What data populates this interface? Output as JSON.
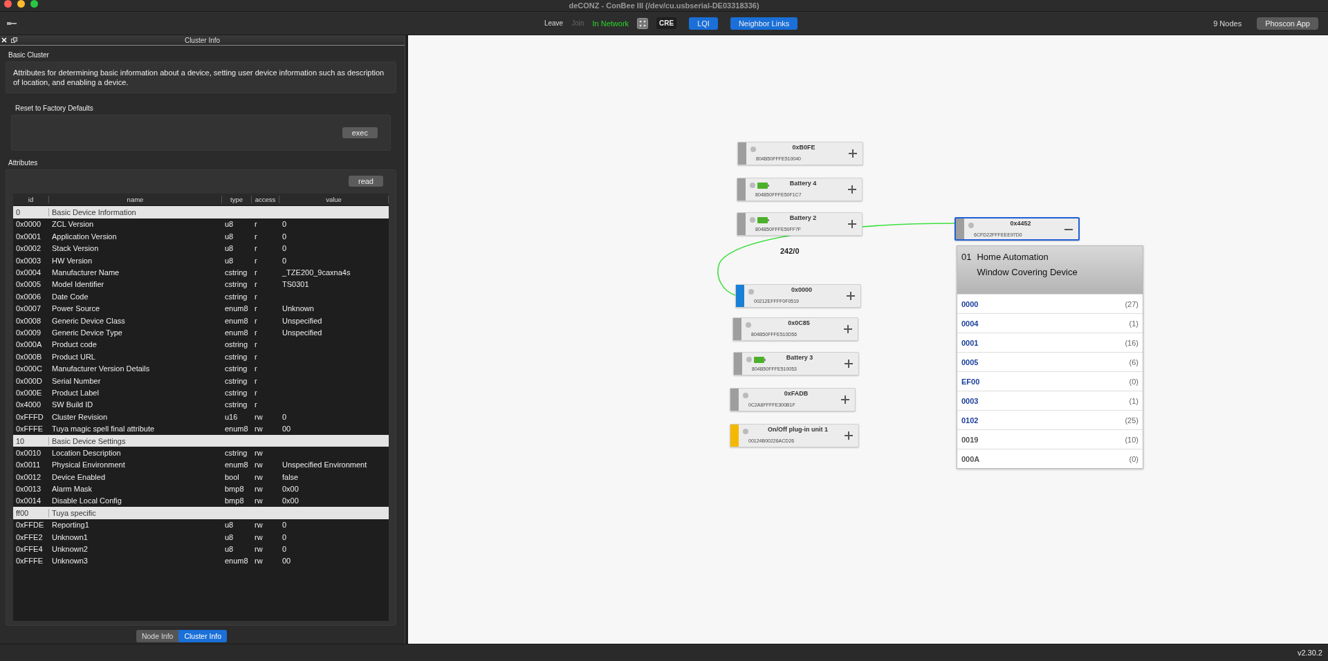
{
  "window": {
    "title": "deCONZ - ConBee III (/dev/cu.usbserial-DE03318336)"
  },
  "toolbar": {
    "leave": {
      "label": "Leave",
      "disabled": false
    },
    "join": {
      "label": "Join",
      "disabled": true
    },
    "status": "In Network",
    "cre": "CRE",
    "toggles": [
      {
        "label": "LQI",
        "on": true
      },
      {
        "label": "Neighbor Links",
        "on": true
      }
    ],
    "node_count": "9 Nodes",
    "phoscon_button": "Phoscon App"
  },
  "cluster_panel": {
    "title": "Cluster Info",
    "cluster_name": "Basic Cluster",
    "description": "Attributes for determining basic information about a device, setting user device information such as description of location, and enabling a device.",
    "commands": [
      {
        "name": "Reset to Factory Defaults",
        "button": "exec"
      }
    ],
    "attributes": {
      "title": "Attributes",
      "read_button": "read",
      "columns": [
        "id",
        "name",
        "type",
        "access",
        "value"
      ],
      "rows": [
        {
          "kind": "group",
          "id": "0",
          "name": "Basic Device Information"
        },
        {
          "kind": "attribute",
          "id": "0x0000",
          "name": "ZCL Version",
          "type": "u8",
          "access": "r",
          "value": "0"
        },
        {
          "kind": "attribute",
          "id": "0x0001",
          "name": "Application Version",
          "type": "u8",
          "access": "r",
          "value": "0"
        },
        {
          "kind": "attribute",
          "id": "0x0002",
          "name": "Stack Version",
          "type": "u8",
          "access": "r",
          "value": "0"
        },
        {
          "kind": "attribute",
          "id": "0x0003",
          "name": "HW Version",
          "type": "u8",
          "access": "r",
          "value": "0"
        },
        {
          "kind": "attribute",
          "id": "0x0004",
          "name": "Manufacturer Name",
          "type": "cstring",
          "access": "r",
          "value": "_TZE200_9caxna4s"
        },
        {
          "kind": "attribute",
          "id": "0x0005",
          "name": "Model Identifier",
          "type": "cstring",
          "access": "r",
          "value": "TS0301"
        },
        {
          "kind": "attribute",
          "id": "0x0006",
          "name": "Date Code",
          "type": "cstring",
          "access": "r"
        },
        {
          "kind": "attribute",
          "id": "0x0007",
          "name": "Power Source",
          "type": "enum8",
          "access": "r",
          "value": "Unknown"
        },
        {
          "kind": "attribute",
          "id": "0x0008",
          "name": "Generic Device Class",
          "type": "enum8",
          "access": "r",
          "value": "Unspecified"
        },
        {
          "kind": "attribute",
          "id": "0x0009",
          "name": "Generic Device Type",
          "type": "enum8",
          "access": "r",
          "value": "Unspecified"
        },
        {
          "kind": "attribute",
          "id": "0x000A",
          "name": "Product code",
          "type": "ostring",
          "access": "r"
        },
        {
          "kind": "attribute",
          "id": "0x000B",
          "name": "Product URL",
          "type": "cstring",
          "access": "r"
        },
        {
          "kind": "attribute",
          "id": "0x000C",
          "name": "Manufacturer Version Details",
          "type": "cstring",
          "access": "r"
        },
        {
          "kind": "attribute",
          "id": "0x000D",
          "name": "Serial Number",
          "type": "cstring",
          "access": "r"
        },
        {
          "kind": "attribute",
          "id": "0x000E",
          "name": "Product Label",
          "type": "cstring",
          "access": "r"
        },
        {
          "kind": "attribute",
          "id": "0x4000",
          "name": "SW Build ID",
          "type": "cstring",
          "access": "r"
        },
        {
          "kind": "attribute",
          "id": "0xFFFD",
          "name": "Cluster Revision",
          "type": "u16",
          "access": "rw",
          "value": "0"
        },
        {
          "kind": "attribute",
          "id": "0xFFFE",
          "name": "Tuya magic spell final attribute",
          "type": "enum8",
          "access": "rw",
          "value": "00"
        },
        {
          "kind": "group",
          "id": "10",
          "name": "Basic Device Settings"
        },
        {
          "kind": "attribute",
          "id": "0x0010",
          "name": "Location Description",
          "type": "cstring",
          "access": "rw"
        },
        {
          "kind": "attribute",
          "id": "0x0011",
          "name": "Physical Environment",
          "type": "enum8",
          "access": "rw",
          "value": "Unspecified Environment"
        },
        {
          "kind": "attribute",
          "id": "0x0012",
          "name": "Device Enabled",
          "type": "bool",
          "access": "rw",
          "value": "false"
        },
        {
          "kind": "attribute",
          "id": "0x0013",
          "name": "Alarm Mask",
          "type": "bmp8",
          "access": "rw",
          "value": "0x00"
        },
        {
          "kind": "attribute",
          "id": "0x0014",
          "name": "Disable Local Config",
          "type": "bmp8",
          "access": "rw",
          "value": "0x00"
        },
        {
          "kind": "group",
          "id": "ff00",
          "name": "Tuya specific"
        },
        {
          "kind": "attribute",
          "id": "0xFFDE",
          "name": "Reporting1",
          "type": "u8",
          "access": "rw",
          "value": "0"
        },
        {
          "kind": "attribute",
          "id": "0xFFE2",
          "name": "Unknown1",
          "type": "u8",
          "access": "rw",
          "value": "0"
        },
        {
          "kind": "attribute",
          "id": "0xFFE4",
          "name": "Unknown2",
          "type": "u8",
          "access": "rw",
          "value": "0"
        },
        {
          "kind": "attribute",
          "id": "0xFFFE",
          "name": "Unknown3",
          "type": "enum8",
          "access": "rw",
          "value": "00"
        }
      ]
    }
  },
  "bottom_tabs": [
    {
      "label": "Node Info",
      "selected": false
    },
    {
      "label": "Cluster Info",
      "selected": true
    }
  ],
  "canvas": {
    "nodes": [
      {
        "name": "0xB0FE",
        "mac": "804B50FFFE510040",
        "color": "#9e9e9e",
        "battery": false,
        "selected": false,
        "expanded": false
      },
      {
        "name": "Battery 4",
        "mac": "804B50FFFE50F1C7",
        "color": "#9e9e9e",
        "battery": true,
        "selected": false,
        "expanded": false
      },
      {
        "name": "Battery 2",
        "mac": "804B50FFFE50FF7F",
        "color": "#9e9e9e",
        "battery": true,
        "selected": false,
        "expanded": false
      },
      {
        "name": "0x0000",
        "mac": "00212EFFFF0F0519",
        "color": "#1a7fd6",
        "battery": false,
        "selected": false,
        "expanded": false
      },
      {
        "name": "0x0C85",
        "mac": "804B50FFFE510D56",
        "color": "#9e9e9e",
        "battery": false,
        "selected": false,
        "expanded": false
      },
      {
        "name": "Battery 3",
        "mac": "804B50FFFE510053",
        "color": "#9e9e9e",
        "battery": true,
        "selected": false,
        "expanded": false
      },
      {
        "name": "0xFADB",
        "mac": "0C2A6FFFFE300B1F",
        "color": "#9e9e9e",
        "battery": false,
        "selected": false,
        "expanded": false
      },
      {
        "name": "On/Off plug-in unit 1",
        "mac": "00124B00226ACD26",
        "color": "#f5b800",
        "battery": false,
        "selected": false,
        "expanded": false
      },
      {
        "name": "0x4452",
        "mac": "6CFD22FFFEEE97D0",
        "color": "#9e9e9e",
        "battery": false,
        "selected": true,
        "expanded": true
      }
    ],
    "link": {
      "label": "242/0"
    },
    "endpoint": {
      "number": "01",
      "profile": "Home Automation",
      "device": "Window Covering Device",
      "clusters": [
        {
          "id": "0000",
          "count": "(27)",
          "kind": "server"
        },
        {
          "id": "0004",
          "count": "(1)",
          "kind": "server"
        },
        {
          "id": "0001",
          "count": "(16)",
          "kind": "server"
        },
        {
          "id": "0005",
          "count": "(6)",
          "kind": "server"
        },
        {
          "id": "EF00",
          "count": "(0)",
          "kind": "server"
        },
        {
          "id": "0003",
          "count": "(1)",
          "kind": "server"
        },
        {
          "id": "0102",
          "count": "(25)",
          "kind": "server"
        },
        {
          "id": "0019",
          "count": "(10)",
          "kind": "client"
        },
        {
          "id": "000A",
          "count": "(0)",
          "kind": "client"
        }
      ]
    }
  },
  "status_bar": {
    "version": "v2.30.2"
  }
}
